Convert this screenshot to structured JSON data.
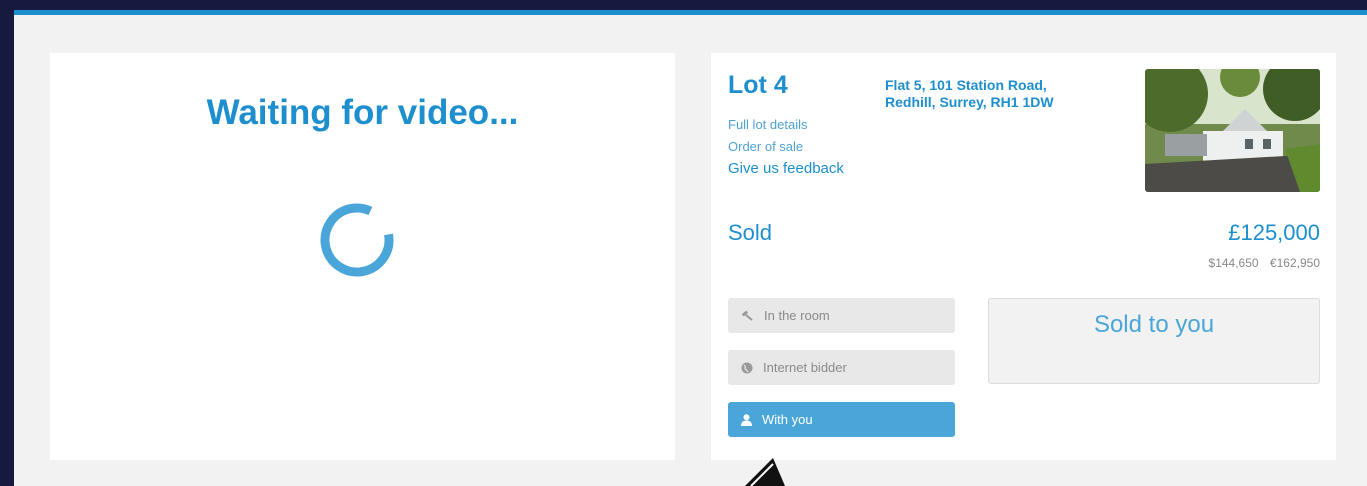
{
  "video": {
    "title": "Waiting for video..."
  },
  "lot": {
    "title": "Lot 4",
    "links": {
      "full_details": "Full lot details",
      "order_of_sale": "Order of sale",
      "feedback": "Give us feedback"
    },
    "address_line1": "Flat 5, 101 Station Road,",
    "address_line2": "Redhill, Surrey, RH1 1DW",
    "status": "Sold",
    "price": "£125,000",
    "price_usd": "$144,650",
    "price_eur": "€162,950",
    "bidders": {
      "room": "In the room",
      "internet": "Internet bidder",
      "you": "With you"
    },
    "sold_message": "Sold to you"
  },
  "colors": {
    "accent": "#1d8fce",
    "active_bidder": "#4aa6d8",
    "background": "#161a3e"
  }
}
